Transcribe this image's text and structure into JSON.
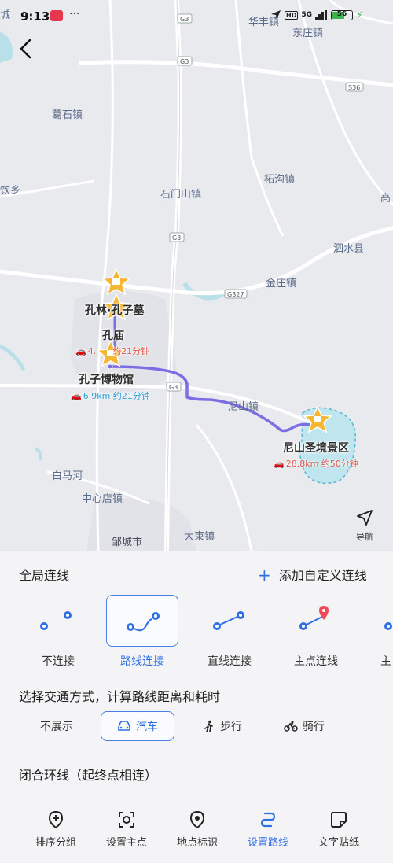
{
  "status_bar": {
    "time": "9:13",
    "dots": "···",
    "network": "5G",
    "hd": "HD",
    "battery": "56"
  },
  "map": {
    "labels": {
      "huafeng": "华丰镇",
      "dongzhuang": "东庄镇",
      "geshi": "葛石镇",
      "bozhen": "柘沟镇",
      "yinxiang": "饮乡",
      "shimenshan": "石门山镇",
      "gao": "高",
      "sishui": "泗水县",
      "jinzhuang": "金庄镇",
      "nishan_town": "尼山镇",
      "baimahe": "白马河",
      "zhongxindian": "中心店镇",
      "zoucheng": "邹城市",
      "dashu": "大束镇",
      "cheng": "城"
    },
    "road_shields": [
      "G3",
      "G3",
      "G3",
      "G3",
      "G327",
      "S36"
    ],
    "pois": {
      "kongmu": {
        "name": "孔林·孔子墓"
      },
      "kongmiao": {
        "name": "孔庙",
        "distance": "4.",
        "time": "约21分钟"
      },
      "museum": {
        "name": "孔子博物馆",
        "distance": "6.9km",
        "time": "约21分钟"
      },
      "nishan": {
        "name": "尼山圣境景区",
        "distance": "28.8km",
        "time": "约50分钟"
      }
    },
    "nav_label": "导航",
    "colors": {
      "route": "#7b6ee3",
      "poi_star": "#f5b731",
      "accent": "#2f6fe6"
    }
  },
  "panel": {
    "global_link_title": "全局连线",
    "add_custom_link": "添加自定义连线",
    "connection_options": [
      {
        "label": "不连接",
        "selected": false
      },
      {
        "label": "路线连接",
        "selected": true
      },
      {
        "label": "直线连接",
        "selected": false
      },
      {
        "label": "主点连线",
        "selected": false
      },
      {
        "label": "主",
        "selected": false
      }
    ],
    "traffic_title": "选择交通方式，计算路线距离和耗时",
    "traffic_options": [
      {
        "label": "不展示",
        "icon": "",
        "selected": false
      },
      {
        "label": "汽车",
        "icon": "car-icon",
        "selected": true
      },
      {
        "label": "步行",
        "icon": "walk-icon",
        "selected": false
      },
      {
        "label": "骑行",
        "icon": "bike-icon",
        "selected": false
      }
    ],
    "loop_title": "闭合环线（起终点相连）"
  },
  "tabs": [
    {
      "label": "排序分组",
      "icon": "add-circle-icon",
      "active": false
    },
    {
      "label": "设置主点",
      "icon": "focus-icon",
      "active": false
    },
    {
      "label": "地点标识",
      "icon": "location-pin-icon",
      "active": false
    },
    {
      "label": "设置路线",
      "icon": "route-icon",
      "active": true
    },
    {
      "label": "文字贴纸",
      "icon": "sticker-icon",
      "active": false
    }
  ]
}
